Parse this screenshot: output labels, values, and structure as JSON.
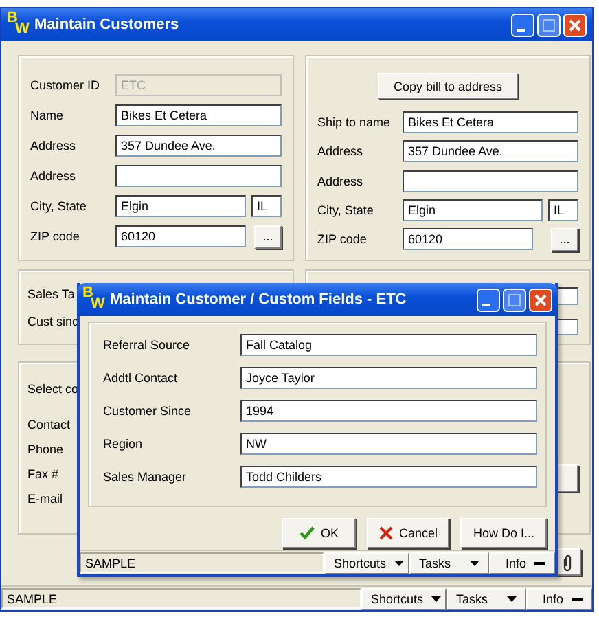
{
  "main_window": {
    "logo": [
      "B",
      "W"
    ],
    "title": "Maintain Customers",
    "bill_to": {
      "fields": [
        {
          "kind": "text",
          "label": "Customer ID",
          "value": "ETC",
          "disabled": true
        },
        {
          "kind": "text",
          "label": "Name",
          "value": "Bikes Et Cetera",
          "disabled": false
        },
        {
          "kind": "text",
          "label": "Address",
          "value": "357 Dundee Ave.",
          "disabled": false
        },
        {
          "kind": "text",
          "label": "Address",
          "disabled": false
        },
        {
          "kind": "city_state",
          "label": "City, State",
          "value": "Elgin",
          "state": "IL",
          "disabled": false
        },
        {
          "kind": "zip",
          "label": "ZIP code",
          "value": "60120",
          "lookup": "...",
          "disabled": false
        }
      ]
    },
    "ship_to": {
      "button": "Copy bill to address",
      "fields": [
        {
          "kind": "text",
          "label": "Ship to name",
          "value": "Bikes Et Cetera"
        },
        {
          "kind": "text",
          "label": "Address",
          "value": "357 Dundee Ave."
        },
        {
          "kind": "text",
          "label": "Address"
        },
        {
          "kind": "city_state",
          "label": "City, State",
          "value": "Elgin",
          "state": "IL"
        },
        {
          "kind": "zip",
          "label": "ZIP code",
          "value": "60120",
          "lookup": "..."
        }
      ]
    },
    "tax_group": {
      "labels": [
        "Sales Ta",
        "Cust sinc"
      ]
    },
    "contact_group": {
      "title": "Select co",
      "labels": [
        "Contact",
        "Phone",
        "Fax #",
        "E-mail"
      ]
    },
    "status_bar": {
      "text": "SAMPLE",
      "menus": [
        {
          "label": "Shortcuts",
          "kind": "dropdown"
        },
        {
          "label": "Tasks",
          "kind": "dropdown"
        },
        {
          "label": "Info",
          "kind": "flyout"
        }
      ]
    }
  },
  "dialog": {
    "logo": [
      "B",
      "W"
    ],
    "title": "Maintain Customer / Custom Fields - ETC",
    "fields": [
      {
        "label": "Referral Source",
        "value": "Fall Catalog"
      },
      {
        "label": "Addtl Contact",
        "value": "Joyce Taylor"
      },
      {
        "label": "Customer Since",
        "value": "1994"
      },
      {
        "label": "Region",
        "value": "NW"
      },
      {
        "label": "Sales Manager",
        "value": "Todd Childers"
      }
    ],
    "buttons": [
      {
        "label": "OK",
        "kind": "ok"
      },
      {
        "label": "Cancel",
        "kind": "cancel"
      },
      {
        "label": "How Do I...",
        "kind": "help"
      }
    ],
    "status_bar": {
      "text": "SAMPLE",
      "menus": [
        {
          "label": "Shortcuts",
          "kind": "dropdown"
        },
        {
          "label": "Tasks",
          "kind": "dropdown"
        },
        {
          "label": "Info",
          "kind": "flyout"
        }
      ]
    }
  }
}
